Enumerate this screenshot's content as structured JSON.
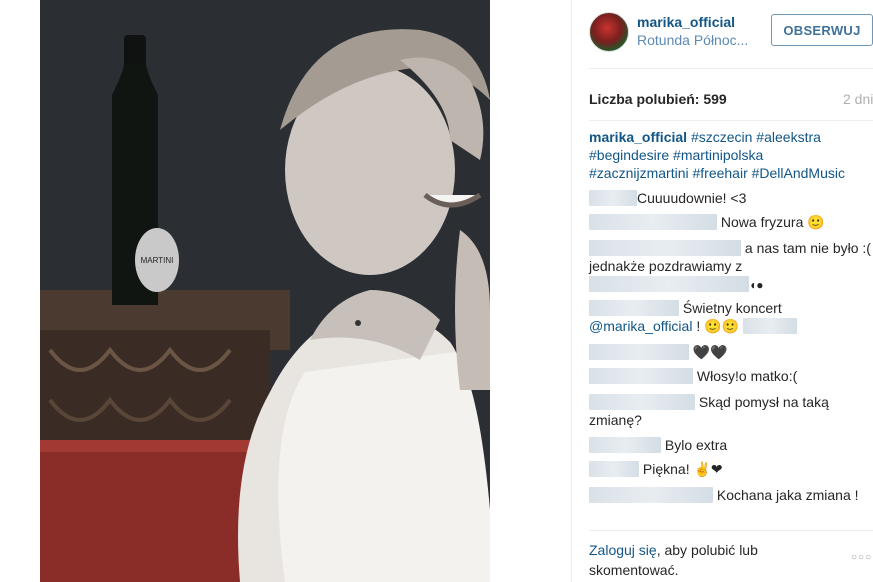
{
  "post": {
    "username": "marika_official",
    "location": "Rotunda Północ...",
    "follow_label": "OBSERWUJ",
    "likes": "Liczba polubień: 599",
    "date": "2 dni"
  },
  "caption": {
    "user": "marika_official",
    "line1": "#szczecin #aleekstra",
    "line2": "#begindesire #martinipolska",
    "line3": "#zacznijzmartini #freehair #DellAndMusic"
  },
  "comments": [
    {
      "text": "Cuuuudownie! <3"
    },
    {
      "text": "Nowa fryzura 🙂"
    },
    {
      "text": "a nas tam nie było :(",
      "line2": "jednakże pozdrawiamy z"
    },
    {
      "text": "Świetny koncert",
      "mention": "@marika_official",
      "extra": "! 🙂🙂"
    },
    {
      "text": "🖤🖤"
    },
    {
      "text": "Włosy!o matko:("
    },
    {
      "text": "Skąd pomysł na taką",
      "line2": "zmianę?"
    },
    {
      "text": "Bylo extra"
    },
    {
      "text": "Piękna! ✌❤"
    },
    {
      "text": "Kochana jaka zmiana !"
    }
  ],
  "footer": {
    "login_link": "Zaloguj się",
    "login_rest": ", aby polubić lub",
    "login_line2": "skomentować.",
    "more": "○○○"
  },
  "photo": {
    "bottle_label": "MARTINI"
  }
}
